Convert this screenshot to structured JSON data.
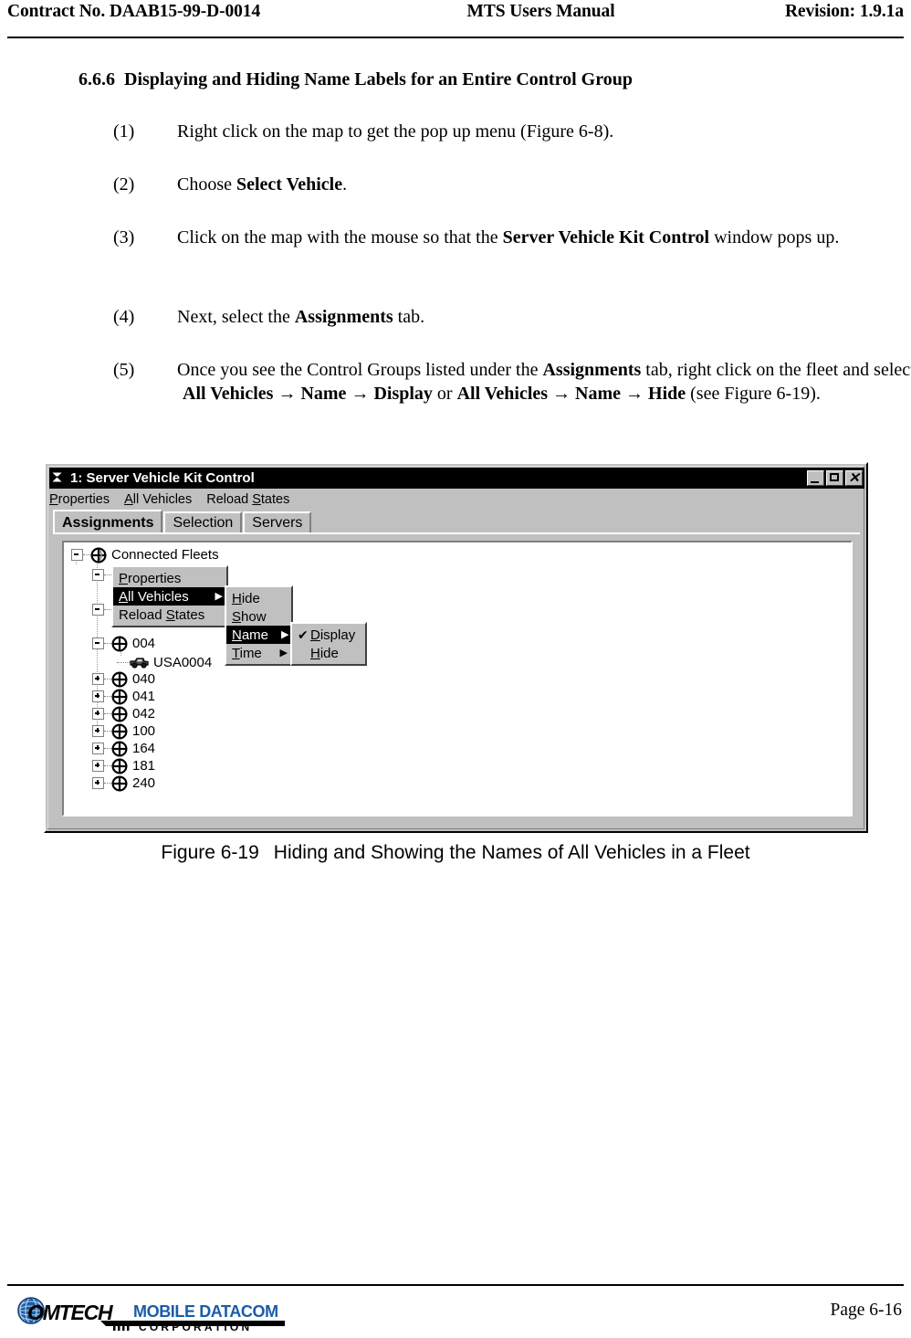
{
  "header": {
    "left": "Contract No. DAAB15-99-D-0014",
    "center": "MTS Users Manual",
    "right": "Revision:  1.9.1a"
  },
  "section": {
    "number": "6.6.6",
    "title": "Displaying and Hiding Name Labels for an Entire Control Group"
  },
  "steps": [
    {
      "n": "(1)",
      "text": "Right click on the map to get the pop up menu (Figure 6-8)."
    },
    {
      "n": "(2)",
      "text": "Choose Select Vehicle."
    },
    {
      "n": "(3)",
      "text": "Click on the map with the mouse so that the Server Vehicle Kit Control window pops up."
    },
    {
      "n": "(4)",
      "text": "Next, select the Assignments tab."
    },
    {
      "n": "(5)",
      "text": "Once you see the Control Groups listed under the Assignments tab, right click on the fleet and select All Vehicles → Name → Display or All Vehicles → Name → Hide (see Figure 6-19)."
    }
  ],
  "figure": {
    "window": {
      "title": "1: Server Vehicle Kit Control",
      "icon": "app-icon",
      "buttons": {
        "minimize": "_",
        "maximize": "□",
        "close": "✕"
      },
      "menubar": [
        "Properties",
        "All Vehicles",
        "Reload States"
      ],
      "tabs": [
        {
          "label": "Assignments",
          "active": true
        },
        {
          "label": "Selection",
          "active": false
        },
        {
          "label": "Servers",
          "active": false
        }
      ],
      "tree": {
        "root": "Connected Fleets",
        "nodes": [
          {
            "label": "004",
            "state": "expanded",
            "child": "USA0004"
          },
          {
            "label": "040",
            "state": "collapsed"
          },
          {
            "label": "041",
            "state": "collapsed"
          },
          {
            "label": "042",
            "state": "collapsed"
          },
          {
            "label": "100",
            "state": "collapsed"
          },
          {
            "label": "164",
            "state": "collapsed"
          },
          {
            "label": "181",
            "state": "collapsed"
          },
          {
            "label": "240",
            "state": "collapsed"
          }
        ]
      },
      "context_menu_1": [
        {
          "label": "Properties",
          "selected": false,
          "submenu": false
        },
        {
          "label": "All Vehicles",
          "selected": true,
          "submenu": true
        },
        {
          "label": "Reload States",
          "selected": false,
          "submenu": false
        }
      ],
      "context_menu_2": [
        {
          "label": "Hide",
          "selected": false,
          "submenu": false
        },
        {
          "label": "Show",
          "selected": false,
          "submenu": false
        },
        {
          "label": "Name",
          "selected": true,
          "submenu": true
        },
        {
          "label": "Time",
          "selected": false,
          "submenu": true
        }
      ],
      "context_menu_3": [
        {
          "label": "Display",
          "selected": false,
          "checked": true
        },
        {
          "label": "Hide",
          "selected": false,
          "checked": false
        }
      ]
    },
    "caption_number": "Figure 6-19",
    "caption_text": "Hiding and Showing the Names of All Vehicles in a Fleet"
  },
  "footer": {
    "logo_primary": "OMTECH",
    "logo_secondary": "MOBILE DATACOM",
    "logo_tertiary": "C O R P O R A T I O N",
    "page": "Page 6-16",
    "logo_blue": "#1a5ca8"
  }
}
